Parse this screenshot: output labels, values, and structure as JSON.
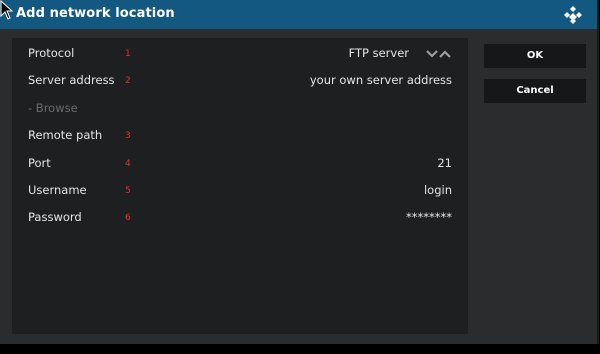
{
  "dialog": {
    "title": "Add network location"
  },
  "fields": [
    {
      "label": "Protocol",
      "number": "1",
      "value": "FTP server",
      "enabled": true
    },
    {
      "label": "Server address",
      "number": "2",
      "value": "your own server address",
      "enabled": true
    },
    {
      "label": "- Browse",
      "number": "",
      "value": "",
      "enabled": false
    },
    {
      "label": "Remote path",
      "number": "3",
      "value": "",
      "enabled": true
    },
    {
      "label": "Port",
      "number": "4",
      "value": "21",
      "enabled": true
    },
    {
      "label": "Username",
      "number": "5",
      "value": "login",
      "enabled": true
    },
    {
      "label": "Password",
      "number": "6",
      "value": "********",
      "enabled": true
    }
  ],
  "buttons": {
    "ok": "OK",
    "cancel": "Cancel"
  },
  "icons": {
    "logo": "kodi-logo-icon",
    "cursor": "mouse-pointer-icon",
    "spinner_down": "chevron-down-icon",
    "spinner_up": "chevron-up-icon"
  },
  "colors": {
    "titlebar": "#125880",
    "dialog_bg": "#2a2c2e",
    "panel_bg": "#1d1f20",
    "annotation_red": "#e53030"
  }
}
